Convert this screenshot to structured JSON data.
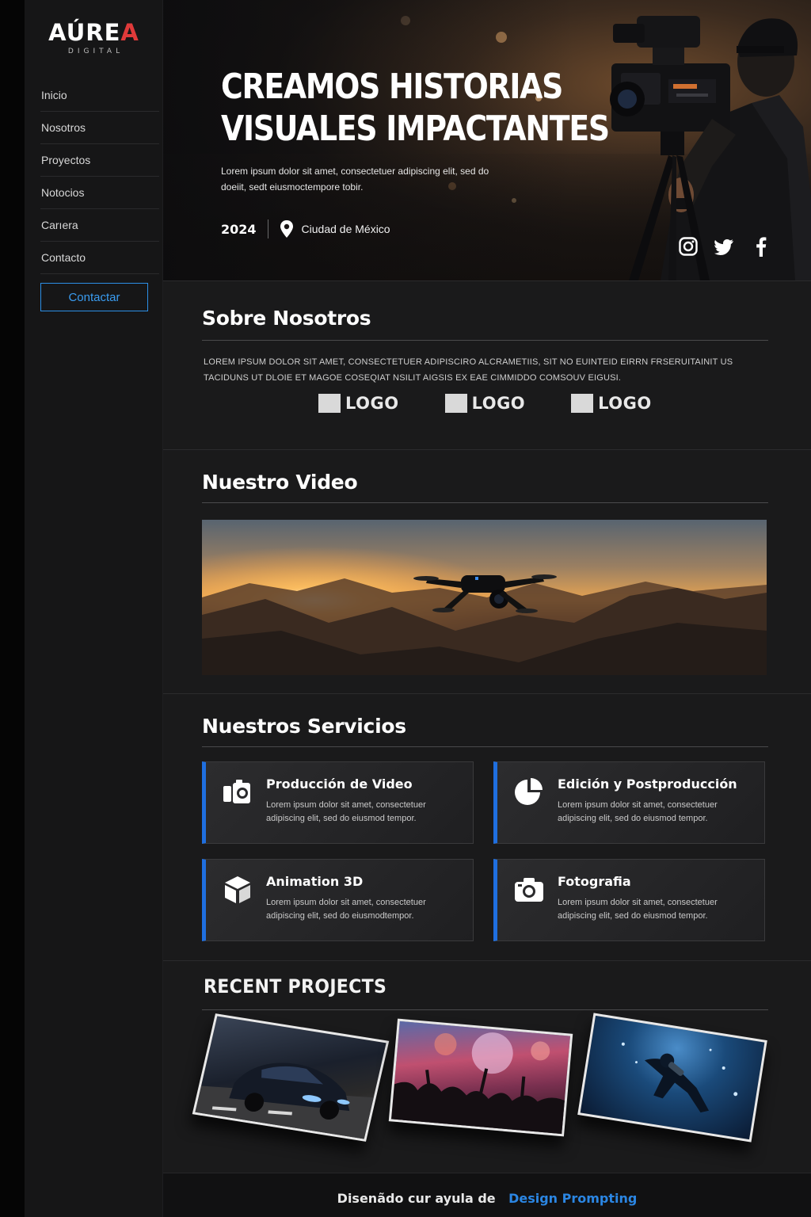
{
  "brand": {
    "name_part1": "AÚRE",
    "name_part2": "A",
    "tagline": "DIGITAL",
    "accent": "#e03a3a"
  },
  "sidebar": {
    "items": [
      {
        "label": "Inicio"
      },
      {
        "label": "Nosotros"
      },
      {
        "label": "Proyectos"
      },
      {
        "label": "Notocios"
      },
      {
        "label": "Carıera"
      },
      {
        "label": "Contacto"
      }
    ],
    "cta_label": "Contactar",
    "cta_color": "#2c8fe6"
  },
  "hero": {
    "title_line1": "CREAMOS HISTORIAS",
    "title_line2": "VISUALES IMPACTANTES",
    "description": "Lorem ipsum dolor sit amet, consectetuer adipiscing elit, sed do doeiit, sedt eiusmoctempore tobir.",
    "year": "2024",
    "location": "Ciudad de México",
    "location_icon": "map-pin-icon",
    "socials": [
      "instagram-icon",
      "twitter-icon",
      "facebook-icon"
    ]
  },
  "about": {
    "title": "Sobre Nosotros",
    "text": "LOREM IPSUM DOLOR SIT AMET, CONSECTETUER ADIPISCIRO ALCRAMETIIS, SIT NO EUINTEID EIRRN FRSERUITAINIT US TACIDUNS UT DLOIE ET MAGOE COSEQIAT NSILIT AIGSIS EX EAE CIMMIDDO COMSOUV EIGUSI.",
    "logos": [
      "LOGO",
      "LOGO",
      "LOGO"
    ]
  },
  "video": {
    "title": "Nuestro Video"
  },
  "services": {
    "title": "Nuestros Servicios",
    "accent": "#1f6fe0",
    "items": [
      {
        "title": "Producción de Video",
        "desc": "Lorem ipsum dolor sit amet, consectetuer adipiscing elit, sed do eiusmod tempor.",
        "icon": "video-camera-icon"
      },
      {
        "title": "Edición y Postproducción",
        "desc": "Lorem ipsum dolor sit amet, consectetuer adipiscing elit, sed do eiusmod tempor.",
        "icon": "pie-chart-icon"
      },
      {
        "title": "Animation 3D",
        "desc": "Lorem ipsum dolor sit amet, consectetuer adipiscing elit, sed do eiusmodtempor.",
        "icon": "cube-icon"
      },
      {
        "title": "Fotografia",
        "desc": "Lorem ipsum dolor sit amet, consectetuer adipiscing elit, sed do eiusmod tempor.",
        "icon": "photo-camera-icon"
      }
    ]
  },
  "projects": {
    "title": "RECENT PROJECTS",
    "items": [
      {
        "theme": "car"
      },
      {
        "theme": "concert"
      },
      {
        "theme": "diver"
      }
    ]
  },
  "footer": {
    "text": "Disenãdo cur ayula de",
    "link": "Design Prompting",
    "link_color": "#2b86e3"
  }
}
